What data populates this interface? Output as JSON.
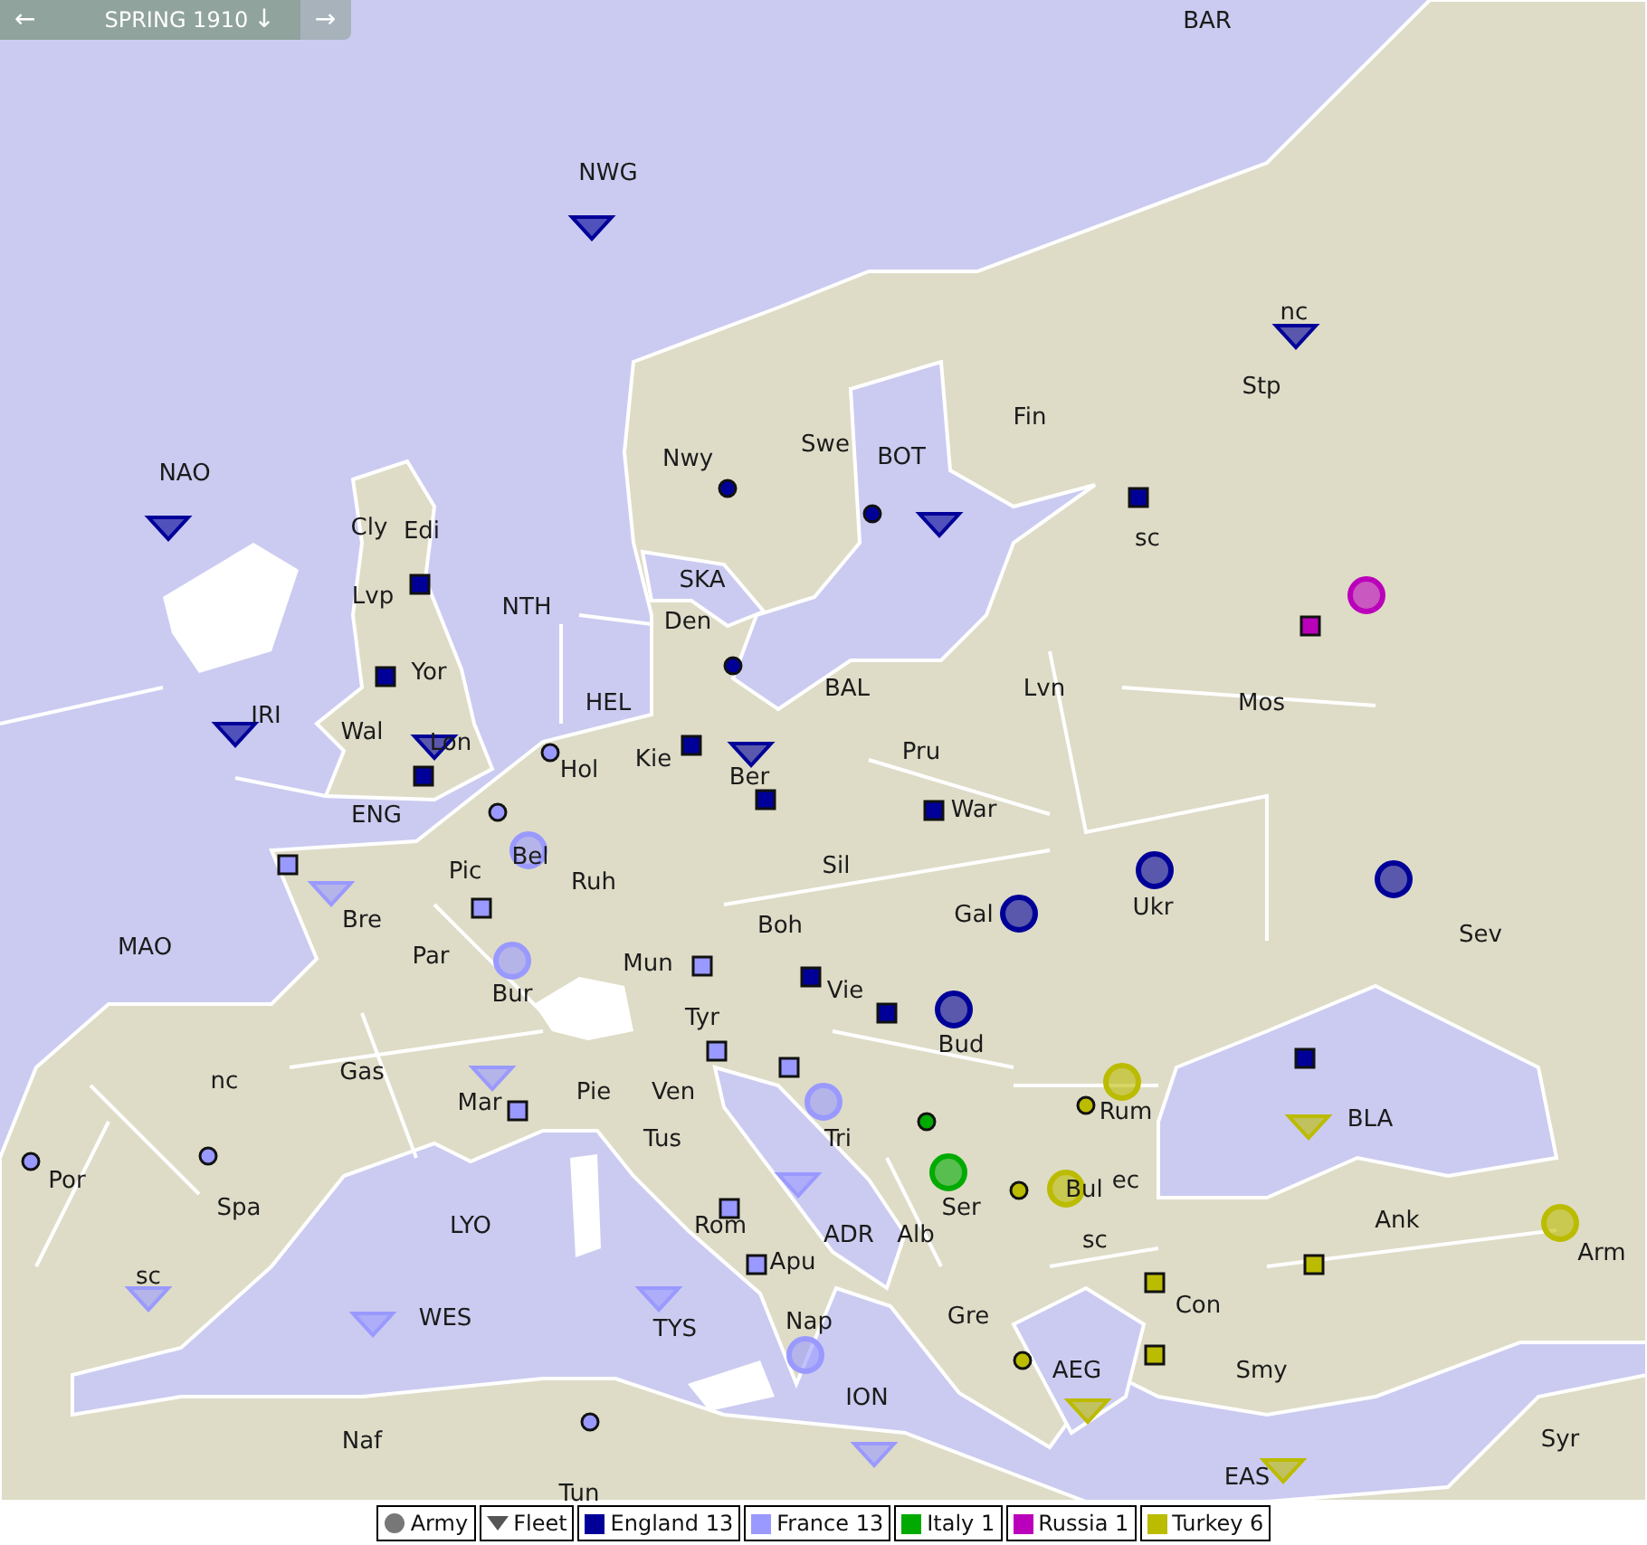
{
  "header": {
    "prev": "←",
    "season": "SPRING 1910",
    "down": "↓",
    "next": "→"
  },
  "labels": [
    "BAR",
    "NWG",
    "NAO",
    "Cly",
    "Edi",
    "Lvp",
    "NTH",
    "Nwy",
    "Swe",
    "BOT",
    "Fin",
    "Stp",
    "nc",
    "sc",
    "SKA",
    "Den",
    "Yor",
    "Wal",
    "IRI",
    "Lon",
    "HEL",
    "BAL",
    "Lvn",
    "Mos",
    "Kie",
    "Ber",
    "Pru",
    "Hol",
    "ENG",
    "War",
    "Bel",
    "Pic",
    "Ruh",
    "Sil",
    "Gal",
    "Ukr",
    "Sev",
    "Bre",
    "MAO",
    "Par",
    "Mun",
    "Boh",
    "Vie",
    "Bur",
    "Bud",
    "Tyr",
    "nc",
    "Gas",
    "Rum",
    "BLA",
    "Mar",
    "Pie",
    "Ven",
    "Tri",
    "Tus",
    "Por",
    "Spa",
    "Ser",
    "Bul",
    "ec",
    "Ank",
    "Arm",
    "LYO",
    "ADR",
    "Alb",
    "Rom",
    "sc",
    "Apu",
    "Con",
    "sc",
    "WES",
    "TYS",
    "Nap",
    "Gre",
    "AEG",
    "Smy",
    "ION",
    "Naf",
    "Syr",
    "EAS",
    "Tun"
  ],
  "units": [
    {
      "kind": "fleet",
      "color": "#000099"
    },
    {
      "kind": "fleet",
      "color": "#000099"
    },
    {
      "kind": "fleet",
      "color": "#000099"
    },
    {
      "kind": "fleet",
      "color": "#000099"
    },
    {
      "kind": "fleet",
      "color": "#000099"
    },
    {
      "kind": "fleet",
      "color": "#000099"
    },
    {
      "kind": "fleet",
      "color": "#000099"
    },
    {
      "kind": "fleet",
      "color": "#9999ff"
    },
    {
      "kind": "fleet",
      "color": "#9999ff"
    },
    {
      "kind": "fleet",
      "color": "#9999ff"
    },
    {
      "kind": "fleet",
      "color": "#9999ff"
    },
    {
      "kind": "fleet",
      "color": "#9999ff"
    },
    {
      "kind": "fleet",
      "color": "#9999ff"
    },
    {
      "kind": "fleet",
      "color": "#9999ff"
    },
    {
      "kind": "fleet",
      "color": "#bbbb00"
    },
    {
      "kind": "fleet",
      "color": "#bbbb00"
    },
    {
      "kind": "fleet",
      "color": "#bbbb00"
    },
    {
      "kind": "army",
      "color": "#9999ff"
    },
    {
      "kind": "army",
      "color": "#9999ff"
    },
    {
      "kind": "army",
      "color": "#9999ff"
    },
    {
      "kind": "army",
      "color": "#9999ff"
    },
    {
      "kind": "army",
      "color": "#000099"
    },
    {
      "kind": "army",
      "color": "#000099"
    },
    {
      "kind": "army",
      "color": "#000099"
    },
    {
      "kind": "army",
      "color": "#000099"
    },
    {
      "kind": "army",
      "color": "#bb00bb"
    },
    {
      "kind": "army",
      "color": "#bbbb00"
    },
    {
      "kind": "army",
      "color": "#bbbb00"
    },
    {
      "kind": "army",
      "color": "#bbbb00"
    },
    {
      "kind": "army",
      "color": "#00aa00"
    }
  ],
  "centers": [
    {
      "kind": "square",
      "color": "#000099"
    },
    {
      "kind": "square",
      "color": "#000099"
    },
    {
      "kind": "square",
      "color": "#000099"
    },
    {
      "kind": "square",
      "color": "#000099"
    },
    {
      "kind": "square",
      "color": "#000099"
    },
    {
      "kind": "square",
      "color": "#000099"
    },
    {
      "kind": "square",
      "color": "#000099"
    },
    {
      "kind": "square",
      "color": "#000099"
    },
    {
      "kind": "square",
      "color": "#000099"
    },
    {
      "kind": "square",
      "color": "#000099"
    },
    {
      "kind": "square",
      "color": "#bb00bb"
    },
    {
      "kind": "square",
      "color": "#9999ff"
    },
    {
      "kind": "square",
      "color": "#9999ff"
    },
    {
      "kind": "square",
      "color": "#9999ff"
    },
    {
      "kind": "square",
      "color": "#9999ff"
    },
    {
      "kind": "square",
      "color": "#9999ff"
    },
    {
      "kind": "square",
      "color": "#9999ff"
    },
    {
      "kind": "square",
      "color": "#9999ff"
    },
    {
      "kind": "square",
      "color": "#9999ff"
    },
    {
      "kind": "square",
      "color": "#bbbb00"
    },
    {
      "kind": "square",
      "color": "#bbbb00"
    },
    {
      "kind": "square",
      "color": "#bbbb00"
    },
    {
      "kind": "dot",
      "color": "#000099"
    },
    {
      "kind": "dot",
      "color": "#000099"
    },
    {
      "kind": "dot",
      "color": "#000099"
    },
    {
      "kind": "dot",
      "color": "#9999ff"
    },
    {
      "kind": "dot",
      "color": "#9999ff"
    },
    {
      "kind": "dot",
      "color": "#9999ff"
    },
    {
      "kind": "dot",
      "color": "#9999ff"
    },
    {
      "kind": "dot",
      "color": "#9999ff"
    },
    {
      "kind": "dot",
      "color": "#00aa00"
    },
    {
      "kind": "dot",
      "color": "#bbbb00"
    },
    {
      "kind": "dot",
      "color": "#bbbb00"
    },
    {
      "kind": "dot",
      "color": "#bbbb00"
    }
  ],
  "legend": [
    {
      "kind": "army",
      "label": "Army"
    },
    {
      "kind": "fleet",
      "label": "Fleet"
    },
    {
      "kind": "power",
      "label": "England 13",
      "color": "#000099"
    },
    {
      "kind": "power",
      "label": "France 13",
      "color": "#9999ff"
    },
    {
      "kind": "power",
      "label": "Italy 1",
      "color": "#00aa00"
    },
    {
      "kind": "power",
      "label": "Russia 1",
      "color": "#bb00bb"
    },
    {
      "kind": "power",
      "label": "Turkey 6",
      "color": "#bbbb00"
    }
  ]
}
